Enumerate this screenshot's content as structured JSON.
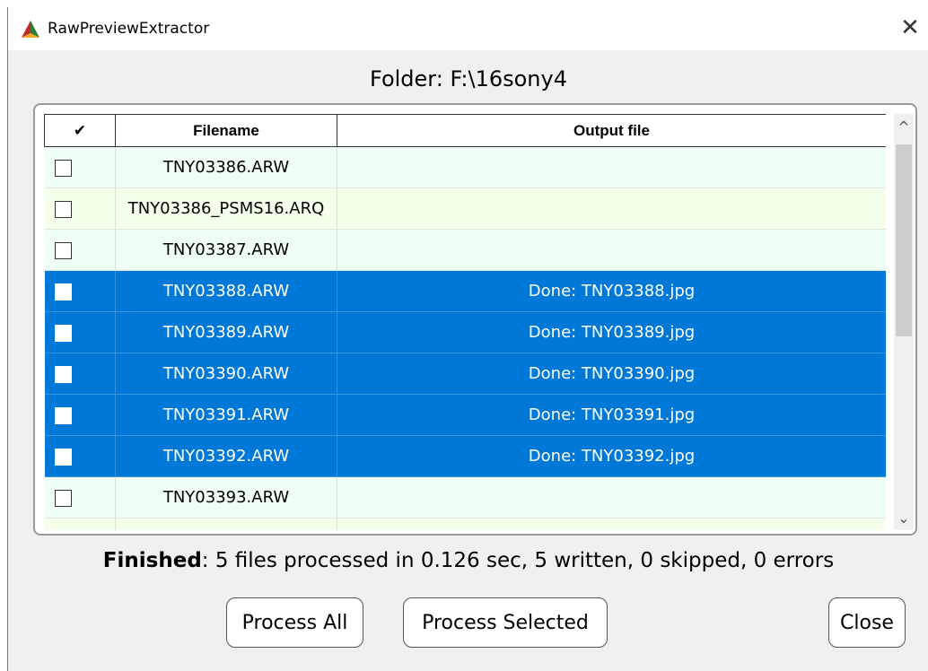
{
  "window": {
    "title": "RawPreviewExtractor",
    "close_glyph": "✕",
    "icon": "app-triangle-icon"
  },
  "folder": {
    "label": "Folder: F:\\16sony4"
  },
  "table": {
    "columns": [
      "✔",
      "Filename",
      "Output file"
    ],
    "rows": [
      {
        "filename": "TNY03386.ARW",
        "output": "",
        "selected": false,
        "checked": false
      },
      {
        "filename": "TNY03386_PSMS16.ARQ",
        "output": "",
        "selected": false,
        "checked": false
      },
      {
        "filename": "TNY03387.ARW",
        "output": "",
        "selected": false,
        "checked": false
      },
      {
        "filename": "TNY03388.ARW",
        "output": "Done: TNY03388.jpg",
        "selected": true,
        "checked": false
      },
      {
        "filename": "TNY03389.ARW",
        "output": "Done: TNY03389.jpg",
        "selected": true,
        "checked": false
      },
      {
        "filename": "TNY03390.ARW",
        "output": "Done: TNY03390.jpg",
        "selected": true,
        "checked": false
      },
      {
        "filename": "TNY03391.ARW",
        "output": "Done: TNY03391.jpg",
        "selected": true,
        "checked": false
      },
      {
        "filename": "TNY03392.ARW",
        "output": "Done: TNY03392.jpg",
        "selected": true,
        "checked": false
      },
      {
        "filename": "TNY03393.ARW",
        "output": "",
        "selected": false,
        "checked": false
      },
      {
        "filename": "",
        "output": "",
        "selected": false,
        "checked": false
      }
    ],
    "scroll_up_glyph": "^",
    "scroll_down_glyph": "⌄"
  },
  "status": {
    "bold": "Finished",
    "text": ": 5 files processed in 0.126 sec, 5 written, 0 skipped, 0 errors"
  },
  "buttons": {
    "process_all": "Process All",
    "process_selected": "Process Selected",
    "close": "Close"
  },
  "colors": {
    "selection": "#0078d7",
    "row_even": "#f0fff5",
    "row_odd": "#f3ffea"
  }
}
